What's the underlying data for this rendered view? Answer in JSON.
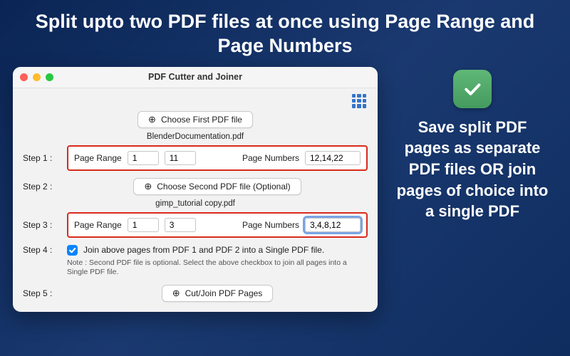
{
  "headline": "Split upto two PDF files at once using Page Range and Page Numbers",
  "window": {
    "title": "PDF Cutter and Joiner",
    "choose_first": "Choose First PDF file",
    "first_filename": "BlenderDocumentation.pdf",
    "choose_second": "Choose Second PDF file (Optional)",
    "second_filename": "gimp_tutorial copy.pdf",
    "cut_join": "Cut/Join PDF Pages",
    "step1_label": "Step 1 :",
    "step2_label": "Step 2 :",
    "step3_label": "Step 3 :",
    "step4_label": "Step 4 :",
    "step5_label": "Step 5 :",
    "page_range_label": "Page Range",
    "page_numbers_label": "Page Numbers",
    "step1": {
      "from": "1",
      "to": "11",
      "numbers": "12,14,22"
    },
    "step3": {
      "from": "1",
      "to": "3",
      "numbers": "3,4,8,12"
    },
    "join_label": "Join above pages from PDF 1 and PDF 2  into a Single PDF file.",
    "note": "Note : Second PDF file is optional. Select the above checkbox to join all pages into a Single PDF file."
  },
  "side_text": "Save split PDF pages as separate PDF files OR join pages of choice into a single PDF"
}
